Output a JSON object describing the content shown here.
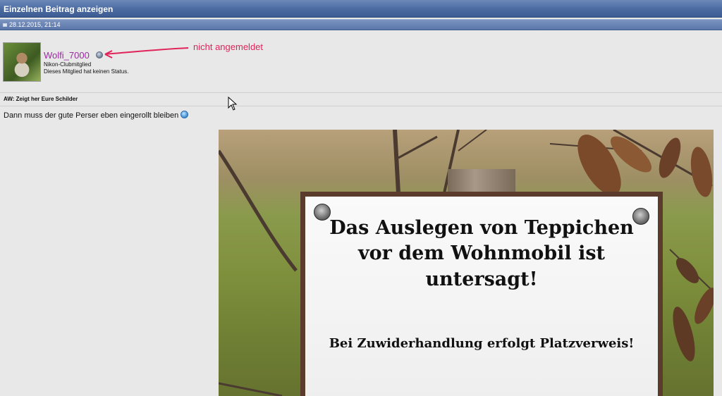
{
  "header": {
    "title": "Einzelnen Beitrag anzeigen"
  },
  "post": {
    "date": "28.12.2015, 21:14",
    "title": "AW: Zeigt her Eure Schilder",
    "text": "Dann muss der gute Perser eben eingerollt bleiben"
  },
  "author": {
    "username": "Wolfi_7000",
    "rank": "Nikon-Clubmitglied",
    "status": "Dieses Mitglied hat keinen Status."
  },
  "annotation": {
    "text": "nicht angemeldet",
    "color": "#e0245a"
  },
  "sign": {
    "line1": "Das Auslegen von Teppichen",
    "line2": "vor dem Wohnmobil ist",
    "line3": "untersagt!",
    "note": "Bei Zuwiderhandlung erfolgt Platzverweis!"
  },
  "colors": {
    "header_bar": "#4a6aa0",
    "username": "#9a2ba0",
    "background": "#e8e8e8"
  },
  "icons": {
    "post": "post-icon",
    "online_status": "status-dot-icon",
    "smiley": "smiley-icon",
    "cursor": "mouse-pointer-icon"
  }
}
